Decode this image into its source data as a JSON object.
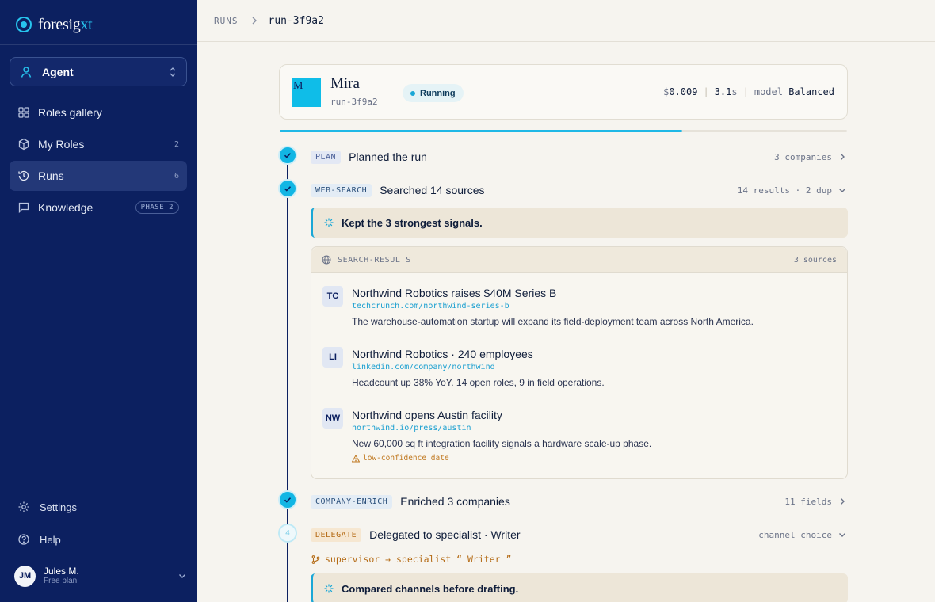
{
  "brand": {
    "name_main": "foresig",
    "name_accent": "xt"
  },
  "agent_select": {
    "label": "Agent"
  },
  "nav": [
    {
      "label": "Roles gallery",
      "count": ""
    },
    {
      "label": "My Roles",
      "count": "2"
    },
    {
      "label": "Runs",
      "count": "6"
    },
    {
      "label": "Knowledge",
      "badge": "PHASE 2"
    }
  ],
  "sidebar_bottom": {
    "settings": "Settings",
    "help": "Help"
  },
  "user": {
    "initials": "JM",
    "name": "Jules M.",
    "plan": "Free plan"
  },
  "breadcrumb": {
    "root": "RUNS",
    "current": "run-3f9a2"
  },
  "run": {
    "avatar_letter": "M",
    "name": "Mira",
    "id": "run-3f9a2",
    "status": "Running",
    "cost_prefix": "$",
    "cost": "0.009",
    "duration": "3.1",
    "duration_unit": "s",
    "model_label": "model",
    "model": "Balanced",
    "progress": 0.71
  },
  "steps": [
    {
      "tag": "PLAN",
      "title": "Planned the run",
      "meta": "3 companies"
    },
    {
      "tag": "WEB-SEARCH",
      "title": "Searched 14 sources",
      "meta": "14 results · 2 dup"
    },
    {
      "tag": "COMPANY-ENRICH",
      "title": "Enriched 3 companies",
      "meta": "11 fields"
    },
    {
      "tag": "DELEGATE",
      "title": "Delegated to specialist · Writer",
      "meta": "channel choice",
      "node_label": "4"
    }
  ],
  "notes": {
    "search": "Kept the 3 strongest signals.",
    "delegate": "Compared channels before drafting."
  },
  "search_results": {
    "title": "SEARCH-RESULTS",
    "count": "3 sources",
    "items": [
      {
        "badge": "TC",
        "title": "Northwind Robotics raises $40M Series B",
        "url": "techcrunch.com/northwind-series-b",
        "desc": "The warehouse-automation startup will expand its field-deployment team across North America."
      },
      {
        "badge": "LI",
        "title": "Northwind Robotics · 240 employees",
        "url": "linkedin.com/company/northwind",
        "desc": "Headcount up 38% YoY. 14 open roles, 9 in field operations."
      },
      {
        "badge": "NW",
        "title": "Northwind opens Austin facility",
        "url": "northwind.io/press/austin",
        "desc": "New 60,000 sq ft integration facility signals a hardware scale-up phase.",
        "warning": "low-confidence date"
      }
    ]
  },
  "delegation": {
    "text": "supervisor → specialist “ Writer ”"
  },
  "colors": {
    "sidebar": "#0c2060",
    "accent": "#12b6e4",
    "delegate": "#b46a14",
    "page": "#f6f4ef"
  }
}
